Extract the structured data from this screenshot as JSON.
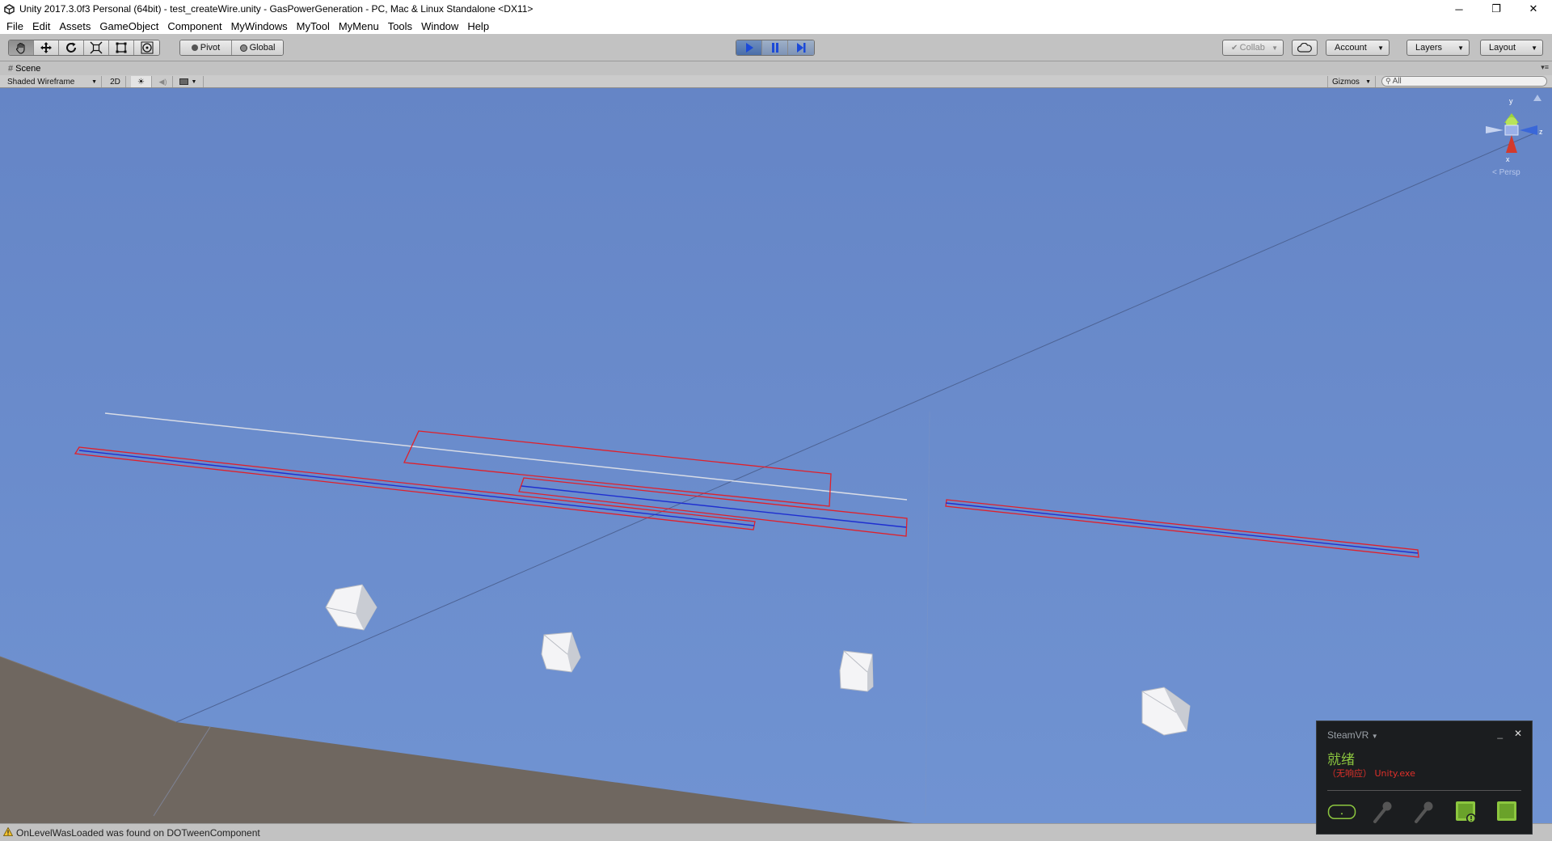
{
  "window": {
    "title": "Unity 2017.3.0f3 Personal (64bit) - test_createWire.unity - GasPowerGeneration - PC, Mac & Linux Standalone <DX11>",
    "minimize_glyph": "─",
    "maximize_glyph": "❐",
    "close_glyph": "✕"
  },
  "menu": [
    "File",
    "Edit",
    "Assets",
    "GameObject",
    "Component",
    "MyWindows",
    "MyTool",
    "MyMenu",
    "Tools",
    "Window",
    "Help"
  ],
  "toolbar": {
    "transform_tools": [
      "hand-icon",
      "move-icon",
      "rotate-icon",
      "scale-icon",
      "rect-icon",
      "transform-icon"
    ],
    "pivot_label": "Pivot",
    "global_label": "Global",
    "collab_label": "Collab",
    "account_label": "Account",
    "layers_label": "Layers",
    "layout_label": "Layout"
  },
  "scene": {
    "tab_label": "Scene",
    "draw_mode": "Shaded Wireframe",
    "mode_2d": "2D",
    "gizmos_label": "Gizmos",
    "search_placeholder": "All",
    "axis_y": "y",
    "axis_z": "z",
    "axis_x": "x",
    "persp_label": "Persp"
  },
  "status": {
    "message": "OnLevelWasLoaded was found on DOTweenComponent"
  },
  "steamvr": {
    "title": "SteamVR",
    "status": "就绪",
    "sub_prefix": "（无响应）",
    "sub_app": "Unity.exe",
    "minimize": "_",
    "close": "✕"
  },
  "colors": {
    "sky": "#6a8ac8",
    "ground": "#6f6760",
    "wire_red": "#e0202a",
    "wire_blue": "#1f2fd0",
    "steam_green": "#8cc63f"
  }
}
